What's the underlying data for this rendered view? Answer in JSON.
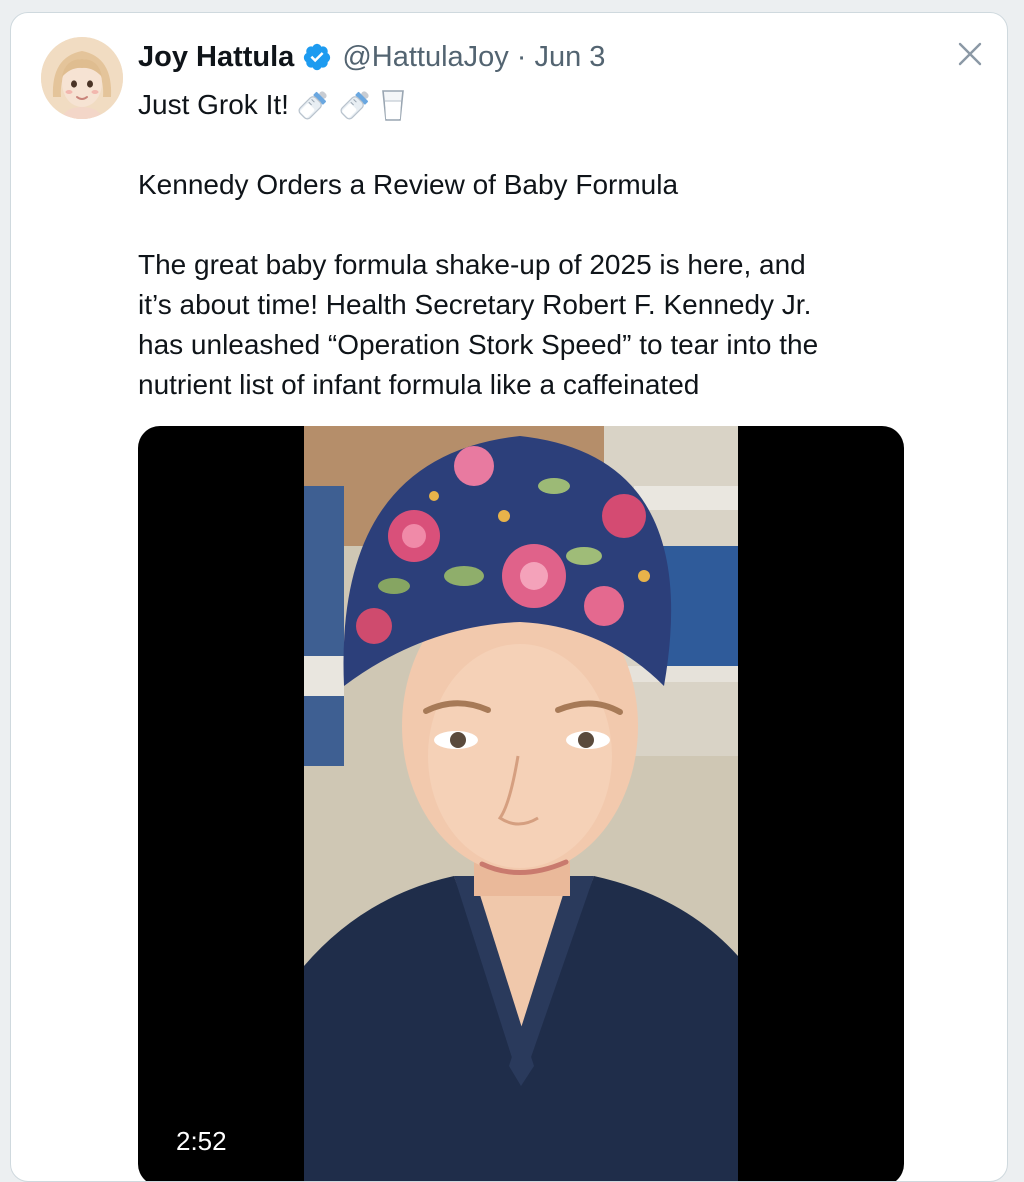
{
  "tweet": {
    "author_name": "Joy Hattula",
    "handle": "@HattulaJoy",
    "separator": "·",
    "date": "Jun 3",
    "verified_icon": "verified-badge-icon",
    "close_icon": "close-icon",
    "line1": "Just Grok It!",
    "line1_emojis": [
      "baby-bottle-icon",
      "baby-bottle-icon",
      "glass-of-milk-icon"
    ],
    "headline": "Kennedy Orders a Review of Baby Formula",
    "body_lines": [
      "The great baby formula shake-up of 2025 is here, and",
      "it’s about time! Health Secretary Robert F. Kennedy Jr.",
      "has unleashed “Operation Stork Speed” to tear into the",
      "nutrient list of infant formula like a caffeinated"
    ]
  },
  "video": {
    "duration": "2:52"
  },
  "colors": {
    "accent": "#1d9bf0",
    "secondary_text": "#536471",
    "text": "#0f1419",
    "border": "#cfd9de"
  }
}
